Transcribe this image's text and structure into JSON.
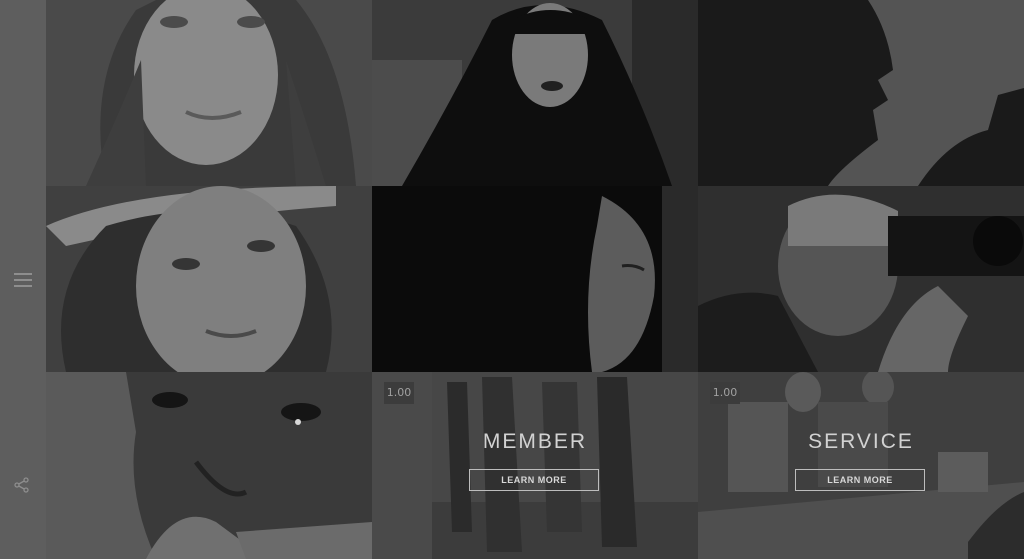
{
  "sidebar": {
    "menu_icon": "hamburger-menu-icon",
    "share_icon": "share-icon"
  },
  "tiles": [
    {
      "photo": "portrait-smiling-woman"
    },
    {
      "photo": "portrait-woman-dark-lipstick"
    },
    {
      "photo": "silhouette-man-profile"
    },
    {
      "photo": "portrait-woman-straw-hat"
    },
    {
      "photo": "profile-girl-shadow"
    },
    {
      "photo": "photographer-with-camera"
    },
    {
      "photo": "closeup-face-tears"
    },
    {
      "photo": "group-standing-room",
      "badge": "1.00",
      "title": "MEMBER",
      "button": "LEARN MORE"
    },
    {
      "photo": "people-at-meeting-table",
      "badge": "1.00",
      "title": "SERVICE",
      "button": "LEARN MORE"
    }
  ],
  "colors": {
    "sidebar": "#5e5e5e",
    "background": "#1a1a1a",
    "text": "#d2d2d2"
  }
}
